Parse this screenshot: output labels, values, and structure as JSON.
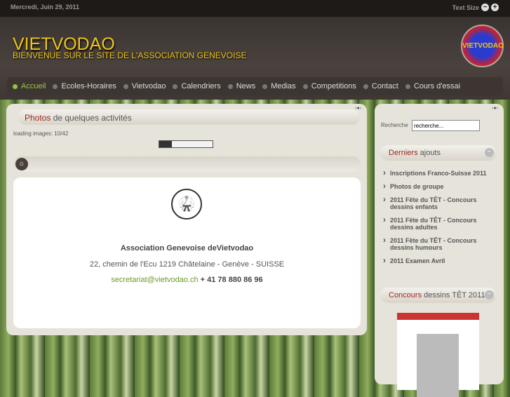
{
  "topbar": {
    "date": "Mercredi, Juin 29, 2011",
    "text_size_label": "Text Size",
    "decrease": "−",
    "increase": "+"
  },
  "header": {
    "title": "VIETVODAO",
    "subtitle": "BIENVENUE SUR LE SITE DE L'ASSOCIATION GENEVOISE",
    "logo_text": "VIETVODAO"
  },
  "nav": [
    {
      "label": "Accueil"
    },
    {
      "label": "Ecoles-Horaires"
    },
    {
      "label": "Vietvodao"
    },
    {
      "label": "Calendriers"
    },
    {
      "label": "News"
    },
    {
      "label": "Medias"
    },
    {
      "label": "Competitions"
    },
    {
      "label": "Contact"
    },
    {
      "label": "Cours d'essai"
    }
  ],
  "main": {
    "heading_highlight": "Photos",
    "heading_rest": " de quelques activités",
    "loading_text": "loading images: 10/42",
    "progress_percent": 24,
    "org": "Association Genevoise deVietvodao",
    "address": "22, chemin de l'Ecu 1219 Châtelaine - Genève - SUISSE",
    "email": "secretariat@vietvodao.ch",
    "phone": " + 41 78 880 86 96"
  },
  "sidebar": {
    "search_label": "Recherche",
    "search_value": "recherche...",
    "latest_highlight": "Derniers",
    "latest_rest": " ajouts",
    "latest": [
      "Inscriptions Franco-Suisse 2011",
      "Photos de groupe",
      "2011 Fête du TÊT - Concours dessins enfants",
      "2011 Fête du TÊT - Concours dessins adultes",
      "2011 Fête du TÊT - Concours dessins humours",
      "2011 Examen Avril"
    ],
    "contest_highlight": "Concours",
    "contest_rest": " dessins TÊT 2011"
  }
}
